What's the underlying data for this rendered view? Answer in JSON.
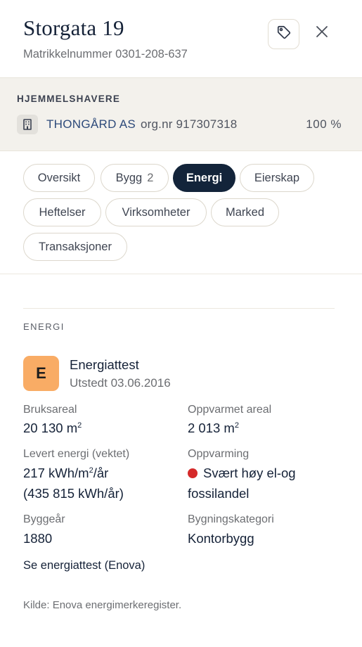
{
  "header": {
    "title": "Storgata 19",
    "subtitle": "Matrikkelnummer 0301-208-637",
    "tag_icon": "tag-icon",
    "close_icon": "close-icon"
  },
  "owners": {
    "label": "HJEMMELSHAVERE",
    "items": [
      {
        "icon": "building-icon",
        "name": "THONGÅRD AS",
        "org": "org.nr 917307318",
        "share": "100 %"
      }
    ]
  },
  "tabs": [
    {
      "label": "Oversikt",
      "count": ""
    },
    {
      "label": "Bygg",
      "count": "2"
    },
    {
      "label": "Energi",
      "count": "",
      "active": true
    },
    {
      "label": "Eierskap",
      "count": ""
    },
    {
      "label": "Heftelser",
      "count": ""
    },
    {
      "label": "Virksomheter",
      "count": ""
    },
    {
      "label": "Marked",
      "count": ""
    },
    {
      "label": "Transaksjoner",
      "count": ""
    }
  ],
  "energy": {
    "section_label": "ENERGI",
    "badge": "E",
    "badge_color": "#f9ac65",
    "cert_title": "Energiattest",
    "cert_date": "Utstedt 03.06.2016",
    "fields": {
      "bruksareal": {
        "label": "Bruksareal",
        "value": "20 130 m",
        "unit_sup": "2"
      },
      "oppvarmet": {
        "label": "Oppvarmet areal",
        "value": "2 013 m",
        "unit_sup": "2"
      },
      "levert": {
        "label": "Levert energi (vektet)",
        "value_a": "217 kWh/m",
        "value_sup": "2",
        "value_b": "/år",
        "value_c": "(435 815 kWh/år)"
      },
      "oppvarming": {
        "label": "Oppvarming",
        "value_line1": "Svært høy el-og",
        "value_line2": "fossilandel",
        "indicator_color": "#d52a2a"
      },
      "byggeaar": {
        "label": "Byggeår",
        "value": "1880"
      },
      "kategori": {
        "label": "Bygningskategori",
        "value": "Kontorbygg"
      }
    },
    "link": "Se energiattest (Enova)",
    "source": "Kilde: Enova energimerkeregister."
  }
}
